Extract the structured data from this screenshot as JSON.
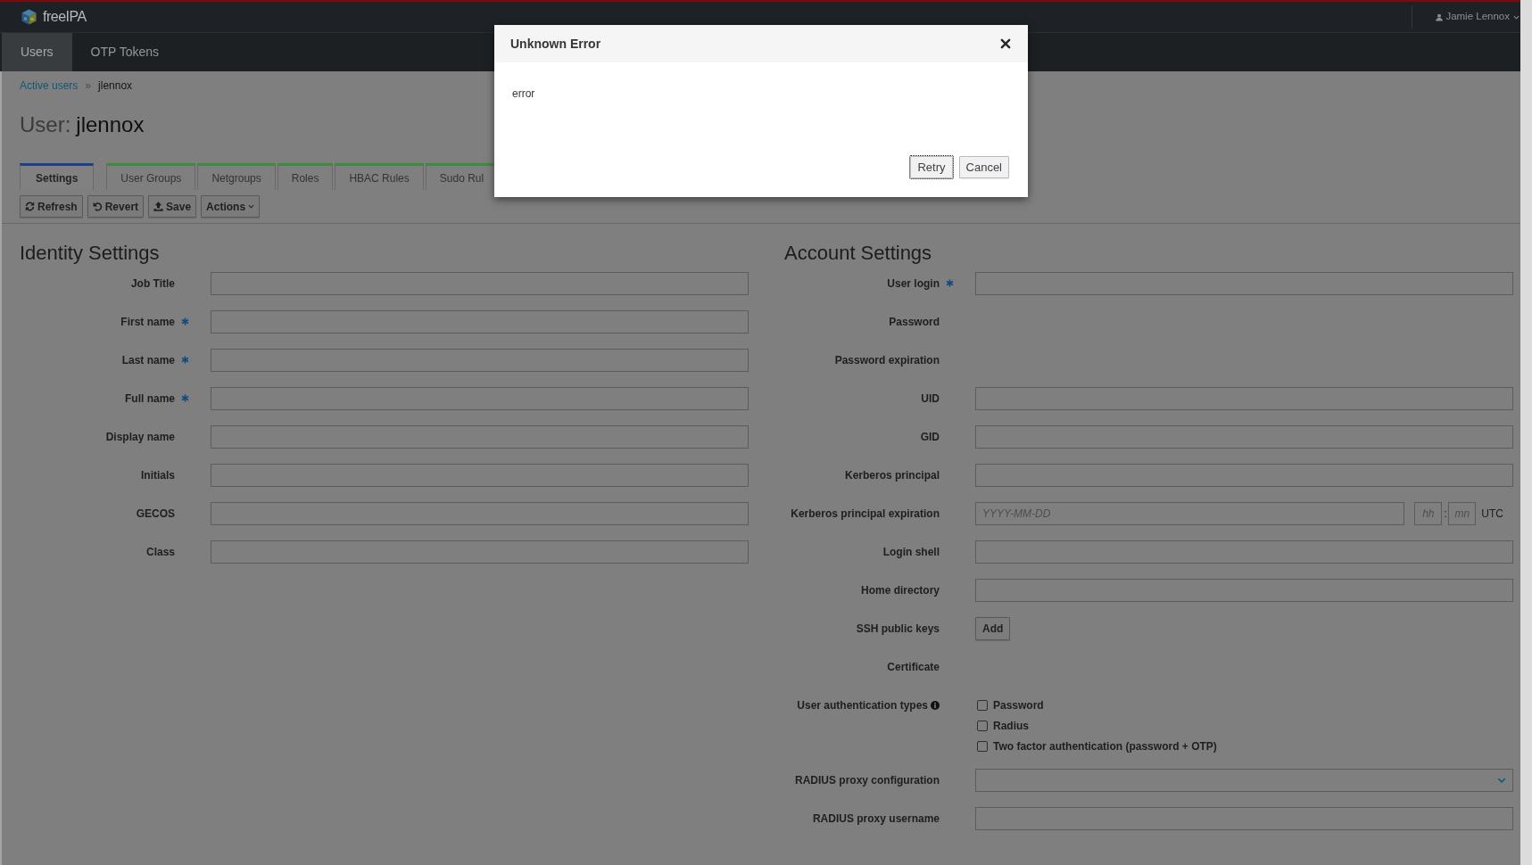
{
  "header": {
    "logo": "freeIPA",
    "user": "Jamie Lennox"
  },
  "nav": [
    {
      "label": "Users",
      "selected": true
    },
    {
      "label": "OTP Tokens",
      "selected": false
    }
  ],
  "breadcrumb": {
    "link": "Active users",
    "separator": "»",
    "current": "jlennox"
  },
  "title": {
    "prefix": "User:",
    "name": "jlennox"
  },
  "tabs": [
    {
      "label": "Settings",
      "selected": true
    },
    {
      "label": "User Groups",
      "selected": false
    },
    {
      "label": "Netgroups",
      "selected": false
    },
    {
      "label": "Roles",
      "selected": false
    },
    {
      "label": "HBAC Rules",
      "selected": false
    },
    {
      "label": "Sudo Rul",
      "selected": false
    }
  ],
  "toolbar": [
    {
      "label": "Refresh",
      "kind": "button"
    },
    {
      "label": "Revert",
      "kind": "button"
    },
    {
      "label": "Save",
      "kind": "button"
    },
    {
      "label": "Actions",
      "kind": "dropdown"
    }
  ],
  "identity_settings": {
    "heading": "Identity Settings",
    "fields": [
      {
        "label": "Job Title",
        "required": false,
        "kind": "text"
      },
      {
        "label": "First name",
        "required": true,
        "kind": "text"
      },
      {
        "label": "Last name",
        "required": true,
        "kind": "text"
      },
      {
        "label": "Full name",
        "required": true,
        "kind": "text"
      },
      {
        "label": "Display name",
        "required": false,
        "kind": "text"
      },
      {
        "label": "Initials",
        "required": false,
        "kind": "text"
      },
      {
        "label": "GECOS",
        "required": false,
        "kind": "text"
      },
      {
        "label": "Class",
        "required": false,
        "kind": "text"
      }
    ]
  },
  "account_settings": {
    "heading": "Account Settings",
    "fields": [
      {
        "label": "User login",
        "required": true,
        "kind": "text"
      },
      {
        "label": "Password",
        "required": false,
        "kind": "empty"
      },
      {
        "label": "Password expiration",
        "required": false,
        "kind": "empty"
      },
      {
        "label": "UID",
        "required": false,
        "kind": "text"
      },
      {
        "label": "GID",
        "required": false,
        "kind": "text"
      },
      {
        "label": "Kerberos principal",
        "required": false,
        "kind": "text"
      },
      {
        "label": "Kerberos principal expiration",
        "required": false,
        "kind": "datetime",
        "date_placeholder": "YYYY-MM-DD",
        "hour_placeholder": "hh",
        "separator": ":",
        "minute_placeholder": "mn",
        "timezone": "UTC"
      },
      {
        "label": "Login shell",
        "required": false,
        "kind": "text"
      },
      {
        "label": "Home directory",
        "required": false,
        "kind": "text"
      },
      {
        "label": "SSH public keys",
        "required": false,
        "kind": "button",
        "button": "Add"
      },
      {
        "label": "Certificate",
        "required": false,
        "kind": "empty"
      },
      {
        "label": "User authentication types",
        "required": false,
        "kind": "checkboxes",
        "help": true,
        "options": [
          {
            "label": "Password",
            "checked": false
          },
          {
            "label": "Radius",
            "checked": false
          },
          {
            "label": "Two factor authentication (password + OTP)",
            "checked": false
          }
        ]
      },
      {
        "label": "RADIUS proxy configuration",
        "required": false,
        "kind": "select"
      },
      {
        "label": "RADIUS proxy username",
        "required": false,
        "kind": "text"
      }
    ]
  },
  "dialog": {
    "title": "Unknown Error",
    "message": "error",
    "buttons": [
      {
        "label": "Retry",
        "focused": true
      },
      {
        "label": "Cancel",
        "focused": false
      }
    ]
  }
}
